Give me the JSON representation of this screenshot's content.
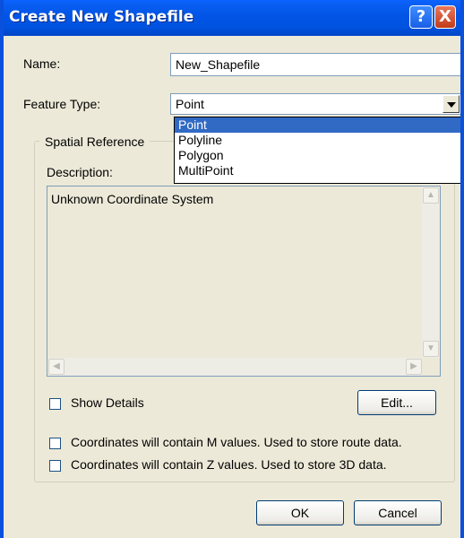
{
  "window": {
    "title": "Create New Shapefile",
    "help_glyph": "?",
    "close_glyph": "X"
  },
  "name": {
    "label": "Name:",
    "value": "New_Shapefile"
  },
  "feature_type": {
    "label": "Feature Type:",
    "selected": "Point",
    "options": [
      "Point",
      "Polyline",
      "Polygon",
      "MultiPoint"
    ]
  },
  "spatial_reference": {
    "group_title": "Spatial Reference",
    "description_label": "Description:",
    "description_text": "Unknown Coordinate System",
    "show_details_label": "Show Details",
    "show_details_checked": false,
    "edit_label": "Edit..."
  },
  "options": {
    "m_values_label": "Coordinates will contain M values. Used to store route data.",
    "m_values_checked": false,
    "z_values_label": "Coordinates will contain Z values. Used to store 3D data.",
    "z_values_checked": false
  },
  "buttons": {
    "ok": "OK",
    "cancel": "Cancel"
  },
  "colors": {
    "titlebar": "#0054e3",
    "dialog_bg": "#ece9d8",
    "selection": "#316ac5"
  }
}
